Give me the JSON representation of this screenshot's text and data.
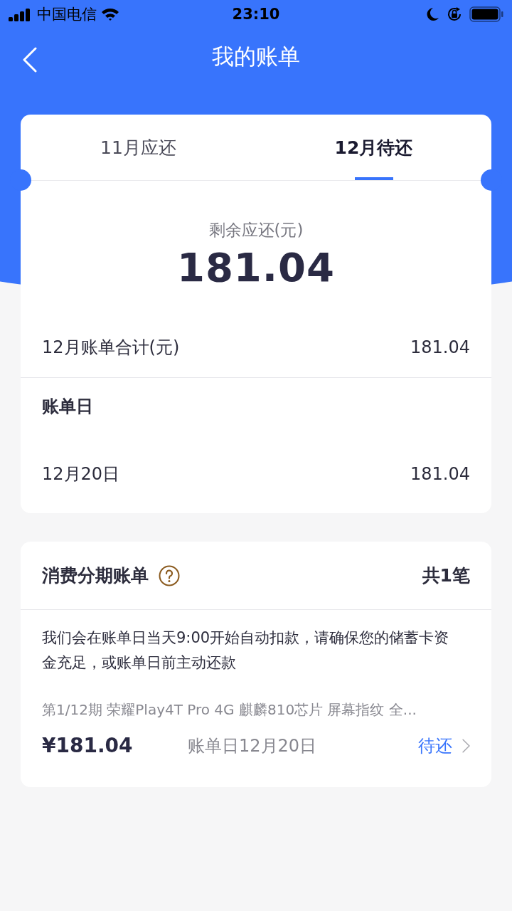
{
  "status_bar": {
    "carrier": "中国电信",
    "time": "23:10"
  },
  "nav": {
    "title": "我的账单"
  },
  "tabs": [
    {
      "label": "11月应还",
      "selected": false
    },
    {
      "label": "12月待还",
      "selected": true
    }
  ],
  "summary": {
    "label": "剩余应还(元)",
    "amount": "181.04"
  },
  "bill_rows": [
    {
      "kind": "row",
      "label": "12月账单合计(元)",
      "value": "181.04"
    },
    {
      "kind": "heading",
      "label": "账单日"
    },
    {
      "kind": "row",
      "label": "12月20日",
      "value": "181.04"
    }
  ],
  "installments": {
    "title": "消费分期账单",
    "count": "共1笔",
    "notice": "我们会在账单日当天9:00开始自动扣款，请确保您的储蓄卡资金充足，或账单日前主动还款",
    "items": [
      {
        "title": "第1/12期 荣耀Play4T Pro 4G 麒麟810芯片 屏幕指纹 全...",
        "amount": "¥181.04",
        "due": "账单日12月20日",
        "status": "待还"
      }
    ]
  }
}
